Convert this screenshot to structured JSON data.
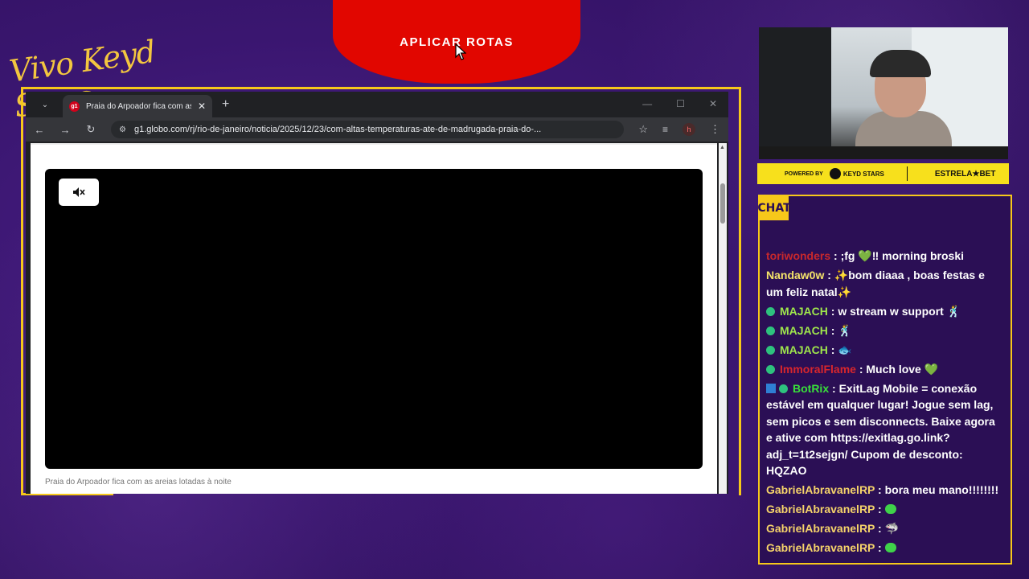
{
  "overlay": {
    "brand_text": "Vivo Keyd Stars",
    "apply_button": "APLICAR ROTAS"
  },
  "browser": {
    "tab_title": "Praia do Arpoador fica com as areias lotadas",
    "tab_favicon": "g1",
    "url": "g1.globo.com/rj/rio-de-janeiro/noticia/2025/12/23/com-altas-temperaturas-ate-de-madrugada-praia-do-...",
    "profile_initial": "h",
    "caption": "Praia do Arpoador fica com as areias lotadas à noite"
  },
  "sponsor": {
    "powered": "POWERED BY",
    "partner": "KEYD STARS",
    "estrela": "ESTRELA★BET"
  },
  "chat": {
    "title": "CHAT",
    "messages": [
      {
        "user": "toriwonders",
        "color": "#c8282c",
        "text": ";fg 💚‼ morning broski"
      },
      {
        "user": "Nandaw0w",
        "color": "#f5e36a",
        "text": "✨bom diaaa , boas festas e um feliz natal✨"
      },
      {
        "user": "MAJACH",
        "color": "#9fe64c",
        "text": "w stream w support 🕺"
      },
      {
        "user": "MAJACH",
        "color": "#9fe64c",
        "text": "🕺"
      },
      {
        "user": "MAJACH",
        "color": "#9fe64c",
        "text": "🐟"
      },
      {
        "user": "ImmoralFlame",
        "color": "#d8262c",
        "text": "Much love 💚"
      },
      {
        "user": "BotRix",
        "color": "#39e03a",
        "text": "ExitLag Mobile = conexão estável em qualquer lugar! Jogue sem lag, sem picos e sem disconnects. Baixe agora e ative com https://exitlag.go.link?adj_t=1t2sejgn/ Cupom de desconto: HQZAO"
      },
      {
        "user": "GabrielAbravanelRP",
        "color": "#f5d36a",
        "text": "bora meu mano!!!!!!!!"
      },
      {
        "user": "GabrielAbravanelRP",
        "color": "#f5d36a",
        "text": ""
      },
      {
        "user": "GabrielAbravanelRP",
        "color": "#f5d36a",
        "text": ""
      },
      {
        "user": "GabrielAbravanelRP",
        "color": "#f5d36a",
        "text": ""
      }
    ]
  }
}
